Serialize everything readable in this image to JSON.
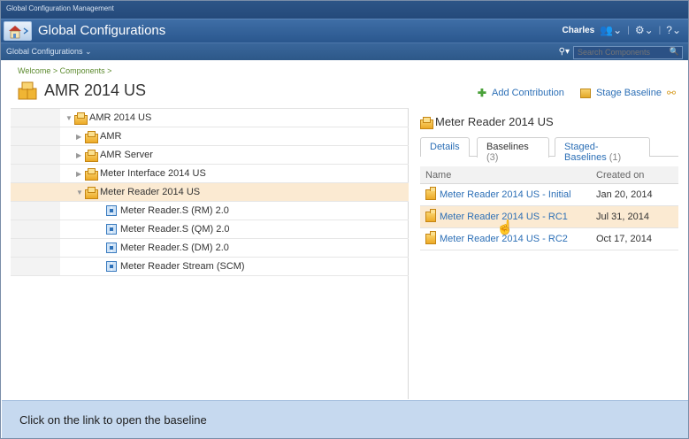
{
  "window": {
    "top_label": "Global Configuration Management"
  },
  "header": {
    "app_title": "Global Configurations",
    "user": "Charles",
    "subnav": "Global Configurations ⌄",
    "search_placeholder": "Search Components"
  },
  "page": {
    "breadcrumb": "Welcome > Components >",
    "title": "AMR 2014 US",
    "actions": {
      "add": "Add Contribution",
      "stage": "Stage Baseline"
    }
  },
  "tree": [
    {
      "label": "AMR 2014 US",
      "level": 0,
      "expander": "expanded",
      "icon": "config-icon",
      "selected": false
    },
    {
      "label": "AMR",
      "level": 1,
      "expander": "collapsed",
      "icon": "config-icon",
      "selected": false
    },
    {
      "label": "AMR Server",
      "level": 1,
      "expander": "collapsed",
      "icon": "config-icon",
      "selected": false
    },
    {
      "label": "Meter Interface 2014 US",
      "level": 1,
      "expander": "collapsed",
      "icon": "config-icon",
      "selected": false
    },
    {
      "label": "Meter Reader 2014 US",
      "level": 1,
      "expander": "expanded",
      "icon": "config-icon",
      "selected": true
    },
    {
      "label": "Meter Reader.S (RM) 2.0",
      "level": 2,
      "expander": "none",
      "icon": "component-icon",
      "selected": false
    },
    {
      "label": "Meter Reader.S (QM) 2.0",
      "level": 2,
      "expander": "none",
      "icon": "component-icon",
      "selected": false
    },
    {
      "label": "Meter Reader.S (DM) 2.0",
      "level": 2,
      "expander": "none",
      "icon": "component-icon",
      "selected": false
    },
    {
      "label": "Meter Reader Stream (SCM)",
      "level": 2,
      "expander": "none",
      "icon": "component-icon",
      "selected": false
    }
  ],
  "details": {
    "title": "Meter Reader 2014 US",
    "tabs": [
      {
        "label": "Details",
        "count": "",
        "active": false
      },
      {
        "label": "Baselines",
        "count": "(3)",
        "active": true
      },
      {
        "label": "Staged-Baselines",
        "count": "(1)",
        "active": false
      }
    ],
    "columns": {
      "name": "Name",
      "created": "Created on"
    },
    "rows": [
      {
        "name": "Meter Reader 2014 US - Initial",
        "created": "Jan 20, 2014",
        "highlight": false
      },
      {
        "name": "Meter Reader 2014 US - RC1",
        "created": "Jul 31, 2014",
        "highlight": true
      },
      {
        "name": "Meter Reader 2014 US - RC2",
        "created": "Oct 17, 2014",
        "highlight": false
      }
    ]
  },
  "hint": "Click on the link to open the baseline",
  "colors": {
    "accent_link": "#2c6fb6",
    "selection": "#fbead2",
    "header": "#2a578e",
    "hint_bg": "#c6d9ef"
  }
}
